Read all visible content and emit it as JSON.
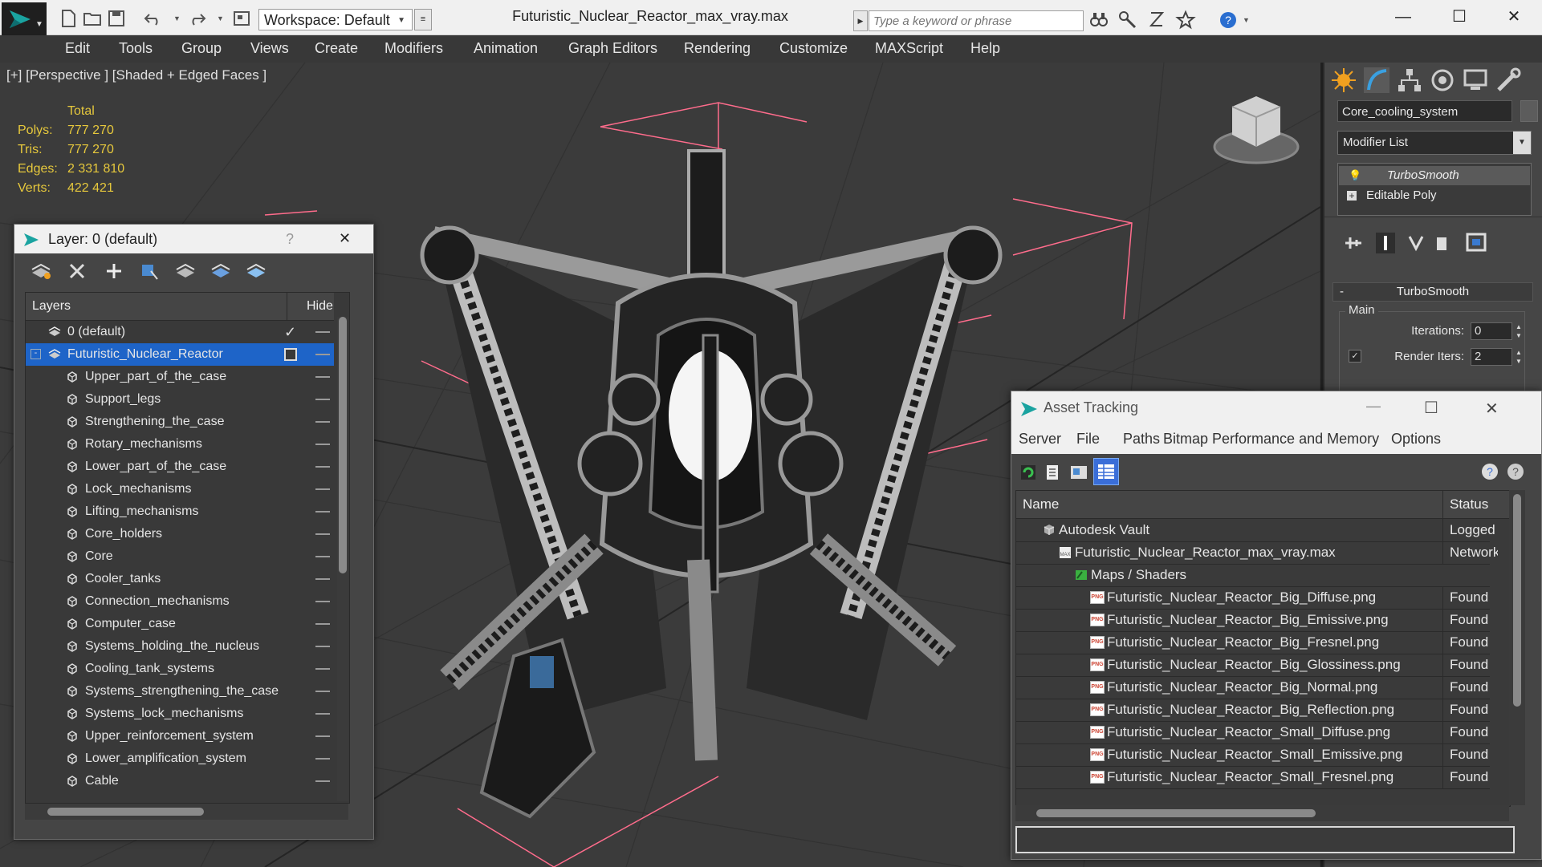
{
  "window": {
    "title": "Futuristic_Nuclear_Reactor_max_vray.max",
    "workspace": "Workspace: Default",
    "search_placeholder": "Type a keyword or phrase",
    "minimize": "—",
    "maximize": "☐",
    "close": "✕"
  },
  "menu": [
    "Edit",
    "Tools",
    "Group",
    "Views",
    "Create",
    "Modifiers",
    "Animation",
    "Graph Editors",
    "Rendering",
    "Customize",
    "MAXScript",
    "Help"
  ],
  "viewport": {
    "label": "[+] [Perspective ] [Shaded + Edged Faces ]",
    "stats": {
      "header": "Total",
      "rows": [
        {
          "key": "Polys:",
          "value": "777 270"
        },
        {
          "key": "Tris:",
          "value": "777 270"
        },
        {
          "key": "Edges:",
          "value": "2 331 810"
        },
        {
          "key": "Verts:",
          "value": "422 421"
        }
      ]
    }
  },
  "command_panel": {
    "object_name": "Core_cooling_system",
    "modifier_list": "Modifier List",
    "stack": [
      "TurboSmooth",
      "Editable Poly"
    ],
    "rollout_title": "TurboSmooth",
    "group_main": "Main",
    "iterations_label": "Iterations:",
    "iterations_value": "0",
    "render_iters_label": "Render Iters:",
    "render_iters_value": "2"
  },
  "layer_dialog": {
    "title": "Layer: 0 (default)",
    "help": "?",
    "close": "✕",
    "col_layers": "Layers",
    "col_hide": "Hide",
    "layers": [
      {
        "name": "0 (default)",
        "type": "layer"
      },
      {
        "name": "Futuristic_Nuclear_Reactor",
        "type": "layer-selected"
      },
      {
        "name": "Upper_part_of_the_case",
        "type": "object"
      },
      {
        "name": "Support_legs",
        "type": "object"
      },
      {
        "name": "Strengthening_the_case",
        "type": "object"
      },
      {
        "name": "Rotary_mechanisms",
        "type": "object"
      },
      {
        "name": "Lower_part_of_the_case",
        "type": "object"
      },
      {
        "name": "Lock_mechanisms",
        "type": "object"
      },
      {
        "name": "Lifting_mechanisms",
        "type": "object"
      },
      {
        "name": "Core_holders",
        "type": "object"
      },
      {
        "name": "Core",
        "type": "object"
      },
      {
        "name": "Cooler_tanks",
        "type": "object"
      },
      {
        "name": "Connection_mechanisms",
        "type": "object"
      },
      {
        "name": "Computer_case",
        "type": "object"
      },
      {
        "name": "Systems_holding_the_nucleus",
        "type": "object"
      },
      {
        "name": "Cooling_tank_systems",
        "type": "object"
      },
      {
        "name": "Systems_strengthening_the_case",
        "type": "object"
      },
      {
        "name": "Systems_lock_mechanisms",
        "type": "object"
      },
      {
        "name": "Upper_reinforcement_system",
        "type": "object"
      },
      {
        "name": "Lower_amplification_system",
        "type": "object"
      },
      {
        "name": "Cable",
        "type": "object"
      }
    ]
  },
  "asset_dialog": {
    "title": "Asset Tracking",
    "menu": [
      "Server",
      "File",
      "Paths",
      "Bitmap Performance and Memory",
      "Options"
    ],
    "col_name": "Name",
    "col_status": "Status",
    "rows": [
      {
        "name": "Autodesk Vault",
        "status": "Logged",
        "level": 0
      },
      {
        "name": "Futuristic_Nuclear_Reactor_max_vray.max",
        "status": "Network",
        "level": 1
      },
      {
        "name": "Maps / Shaders",
        "status": "",
        "level": 2
      },
      {
        "name": "Futuristic_Nuclear_Reactor_Big_Diffuse.png",
        "status": "Found",
        "level": 3
      },
      {
        "name": "Futuristic_Nuclear_Reactor_Big_Emissive.png",
        "status": "Found",
        "level": 3
      },
      {
        "name": "Futuristic_Nuclear_Reactor_Big_Fresnel.png",
        "status": "Found",
        "level": 3
      },
      {
        "name": "Futuristic_Nuclear_Reactor_Big_Glossiness.png",
        "status": "Found",
        "level": 3
      },
      {
        "name": "Futuristic_Nuclear_Reactor_Big_Normal.png",
        "status": "Found",
        "level": 3
      },
      {
        "name": "Futuristic_Nuclear_Reactor_Big_Reflection.png",
        "status": "Found",
        "level": 3
      },
      {
        "name": "Futuristic_Nuclear_Reactor_Small_Diffuse.png",
        "status": "Found",
        "level": 3
      },
      {
        "name": "Futuristic_Nuclear_Reactor_Small_Emissive.png",
        "status": "Found",
        "level": 3
      },
      {
        "name": "Futuristic_Nuclear_Reactor_Small_Fresnel.png",
        "status": "Found",
        "level": 3
      }
    ]
  },
  "colors": {
    "accent": "#1e64c8",
    "stats": "#e6c83c",
    "bbox": "#ff6c8c"
  }
}
